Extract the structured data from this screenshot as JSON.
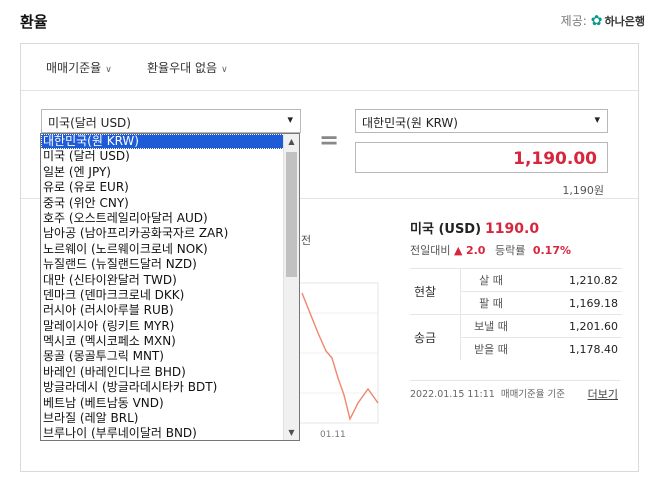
{
  "header": {
    "title": "환율",
    "provider_label": "제공:",
    "provider_name": "하나은행",
    "provider_logo": "hana-logo"
  },
  "filters": [
    {
      "label": "매매기준율",
      "icon": "chevron-down-icon"
    },
    {
      "label": "환율우대 없음",
      "icon": "chevron-down-icon"
    }
  ],
  "converter": {
    "from_currency": "미국(달러 USD)",
    "to_currency": "대한민국(원 KRW)",
    "to_amount": "1,190.00",
    "to_amount_sub": "1,190원"
  },
  "dropdown": {
    "options": [
      "대한민국(원 KRW)",
      "미국 (달러 USD)",
      "일본 (엔 JPY)",
      "유로 (유로 EUR)",
      "중국 (위안 CNY)",
      "호주 (오스트레일리아달러 AUD)",
      "남아공 (남아프리카공화국자르 ZAR)",
      "노르웨이 (노르웨이크로네 NOK)",
      "뉴질랜드 (뉴질랜드달러 NZD)",
      "대만 (신타이완달러 TWD)",
      "덴마크 (덴마크크로네 DKK)",
      "러시아 (러시아루블 RUB)",
      "말레이시아 (링키트 MYR)",
      "멕시코 (멕시코페소 MXN)",
      "몽골 (몽골투그릭 MNT)",
      "바레인 (바레인디나르 BHD)",
      "방글라데시 (방글라데시타카 BDT)",
      "베트남 (베트남동 VND)",
      "브라질 (레알 BRL)",
      "브루나이 (부루네이달러 BND)"
    ],
    "selected_index": 0
  },
  "chart_fragment": {
    "partial_label": "전",
    "x_tick": "01.11",
    "line_color": "#f0876e"
  },
  "info": {
    "pair": "미국 (USD)",
    "rate": "1190.0",
    "change_label": "전일대비",
    "change_value": "2.0",
    "change_label2": "등락률",
    "change_pct": "0.17%"
  },
  "rates": {
    "cash_label": "현찰",
    "remit_label": "송금",
    "rows": [
      {
        "kind": "살 때",
        "value": "1,210.82"
      },
      {
        "kind": "팔 때",
        "value": "1,169.18"
      },
      {
        "kind": "보낼 때",
        "value": "1,201.60"
      },
      {
        "kind": "받을 때",
        "value": "1,178.40"
      }
    ]
  },
  "footer": {
    "timestamp": "2022.01.15 11:11",
    "basis": "매매기준율 기준",
    "more": "더보기"
  },
  "colors": {
    "accent_red": "#d7263d",
    "selection_blue": "#1e5bd6"
  }
}
